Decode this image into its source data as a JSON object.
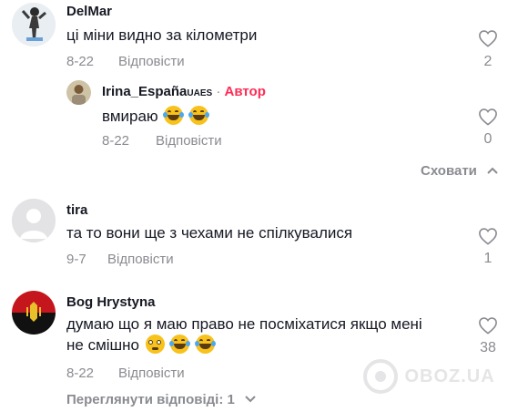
{
  "comments": [
    {
      "author": "DelMar",
      "text": "ці міни видно за кілометри",
      "date": "8-22",
      "reply_label": "Відповісти",
      "likes": "2"
    },
    {
      "author": "Irina_España",
      "author_badge": "UAES",
      "dot": "·",
      "author_tag": "Автор",
      "text": "вмираю",
      "date": "8-22",
      "reply_label": "Відповісти",
      "likes": "0"
    },
    {
      "author": "tira",
      "text": "та то вони ще з чехами не спілкувалися",
      "date": "9-7",
      "reply_label": "Відповісти",
      "likes": "1"
    },
    {
      "author": "Bog Hrystyna",
      "text_line1": "думаю що я маю право не посміхатися якщо мені",
      "text_line2": "не смішно",
      "date": "8-22",
      "reply_label": "Відповісти",
      "likes": "38"
    }
  ],
  "hide_label": "Сховати",
  "view_replies_label": "Переглянути відповіді: 1",
  "watermark": "OBOZ.UA",
  "icons": {
    "like": "heart-outline-icon",
    "chevron_up": "chevron-up-icon",
    "chevron_down": "chevron-down-icon"
  },
  "colors": {
    "author_tag": "#fe2c55",
    "muted": "#8a8b91",
    "text": "#161823"
  }
}
